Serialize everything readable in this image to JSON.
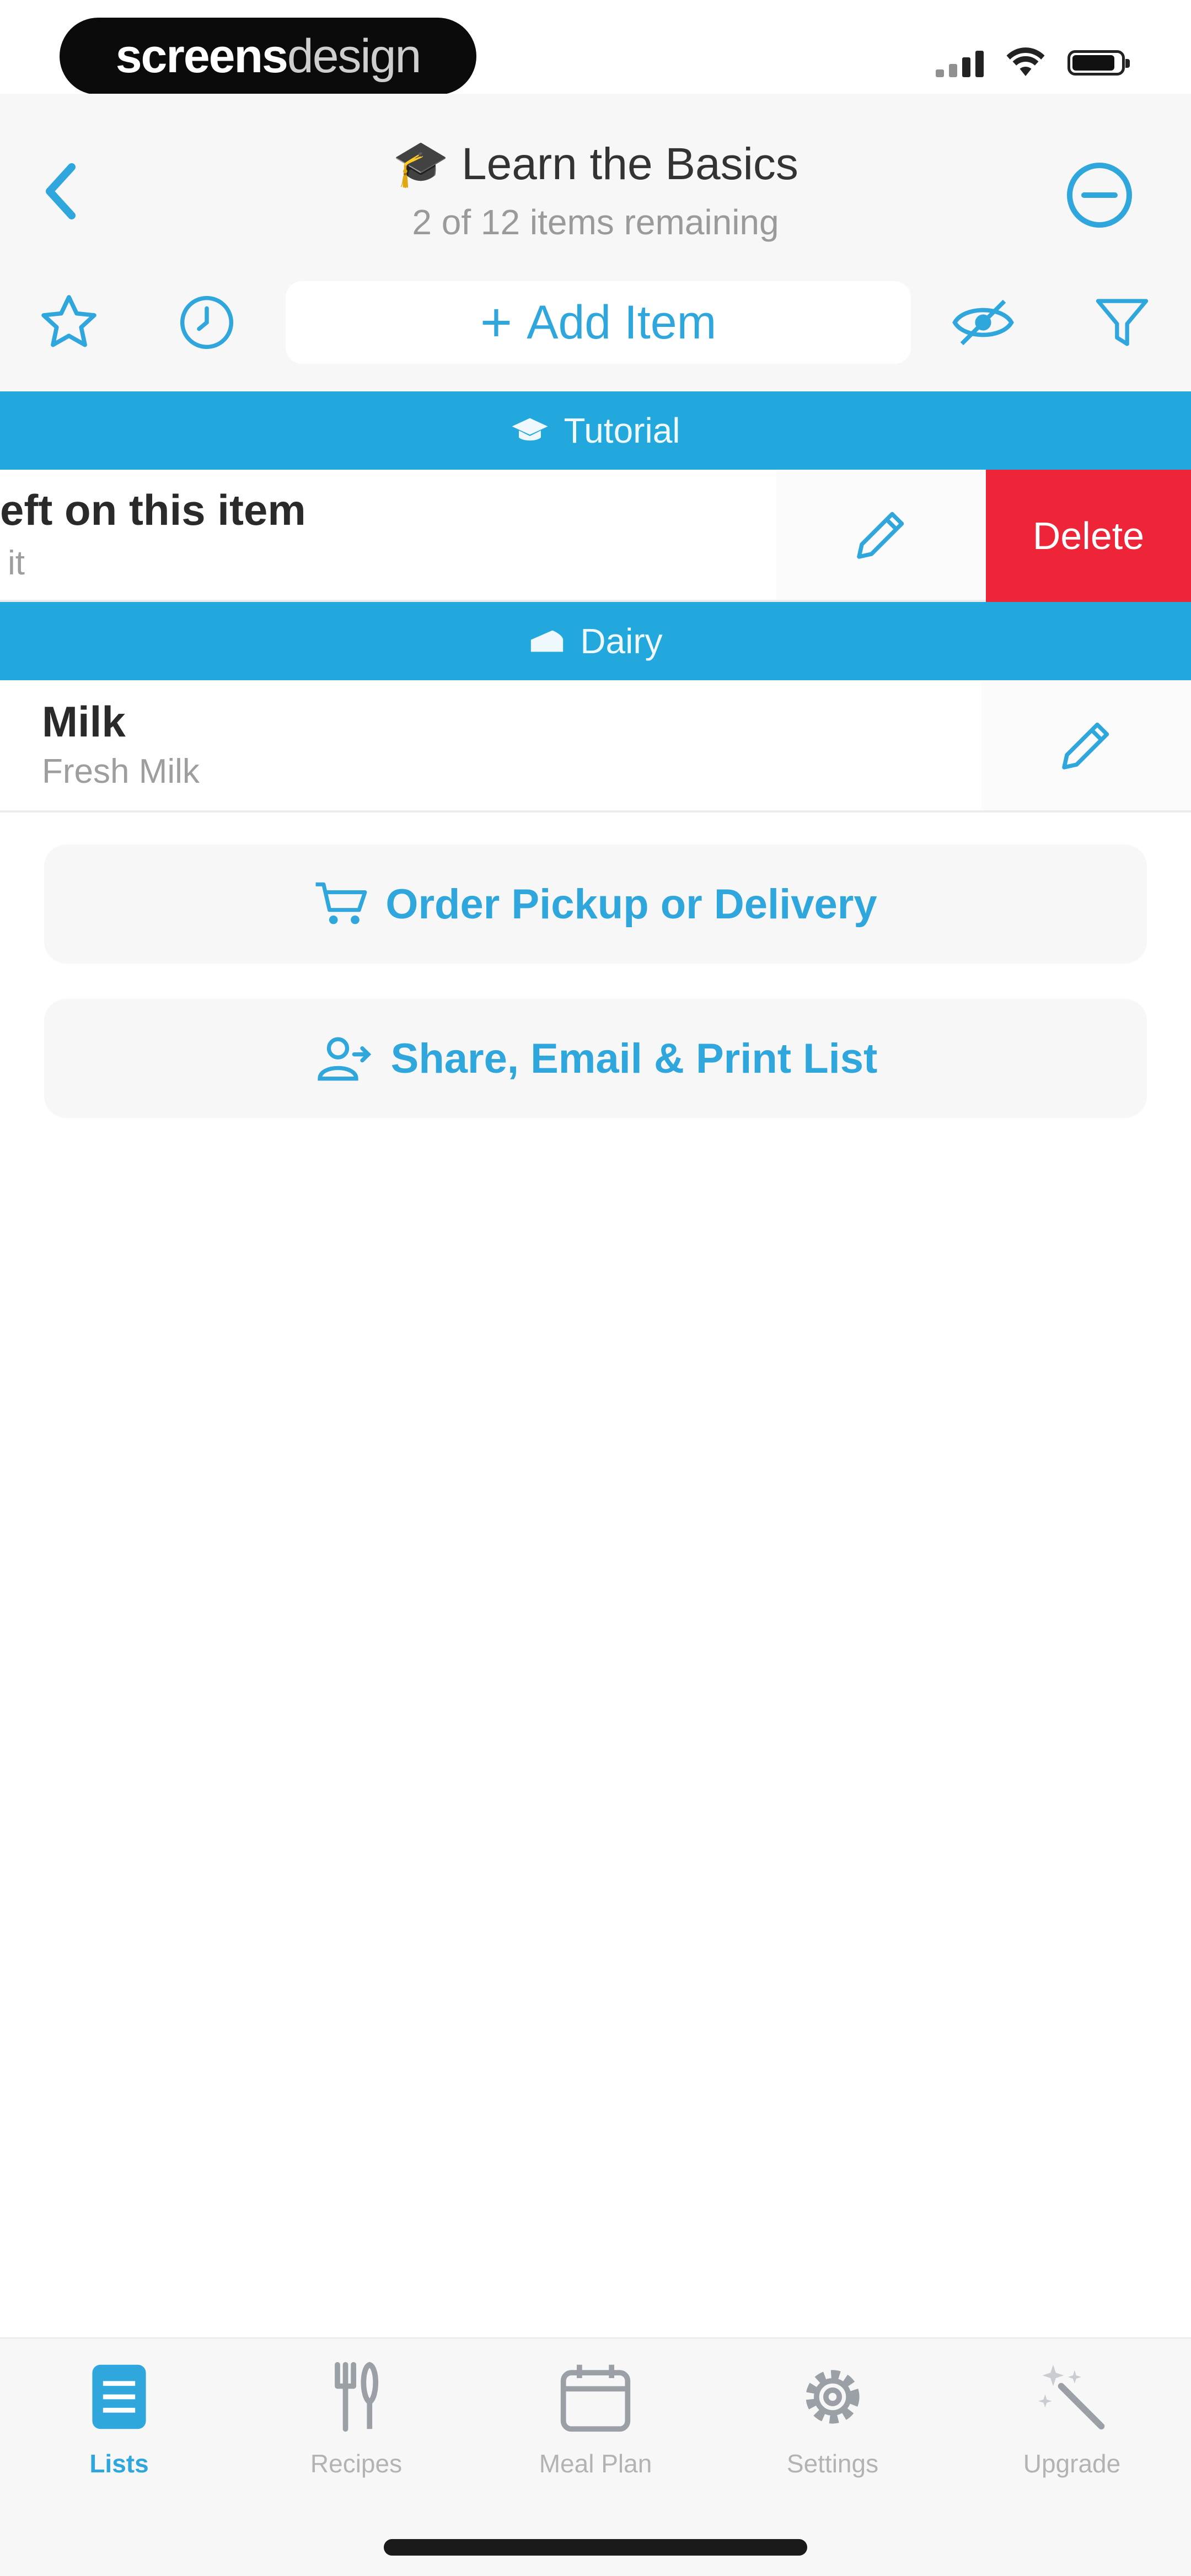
{
  "status_bar": {
    "brand_bold": "screens",
    "brand_light": "design"
  },
  "nav": {
    "title_emoji": "🎓",
    "title": "Learn the Basics",
    "subtitle": "2 of 12 items remaining"
  },
  "toolbar": {
    "add_item_label": "Add Item"
  },
  "sections": [
    {
      "name": "Tutorial",
      "items": [
        {
          "title": "eft on this item",
          "subtitle": "it",
          "delete_label": "Delete"
        }
      ]
    },
    {
      "name": "Dairy",
      "items": [
        {
          "title": "Milk",
          "subtitle": "Fresh Milk"
        }
      ]
    }
  ],
  "actions": {
    "order_label": "Order Pickup or Delivery",
    "share_label": "Share, Email & Print List"
  },
  "tabs": [
    {
      "label": "Lists",
      "icon": "list-icon",
      "active": true
    },
    {
      "label": "Recipes",
      "icon": "utensils-icon"
    },
    {
      "label": "Meal Plan",
      "icon": "calendar-icon"
    },
    {
      "label": "Settings",
      "icon": "gear-icon"
    },
    {
      "label": "Upgrade",
      "icon": "magic-wand-icon"
    }
  ],
  "colors": {
    "accent": "#22a8dd",
    "delete": "#ee2538",
    "nav_bg": "#f7f7f8"
  }
}
